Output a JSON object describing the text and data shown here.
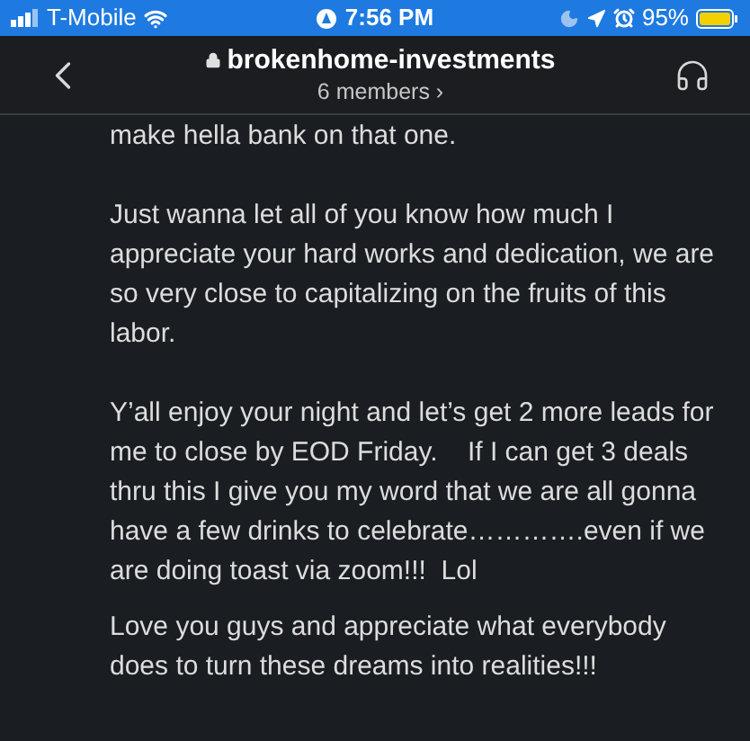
{
  "status_bar": {
    "carrier": "T-Mobile",
    "time": "7:56 PM",
    "battery_percent": "95%"
  },
  "header": {
    "channel": "brokenhome-investments",
    "members": "6 members",
    "members_chevron": "›"
  },
  "messages": [
    {
      "paragraphs": [
        "make hella bank on that one.",
        "Just wanna let all of you know how much I appreciate your hard works and dedication, we are so very close to capitalizing on the fruits of this labor.",
        "Y’all enjoy your night and let’s get 2 more leads for me to close by EOD Friday.    If I can get 3 deals thru this I give you my word that we are all gonna have a few drinks to celebrate………….even if we are doing toast via zoom!!!  Lol"
      ]
    },
    {
      "paragraphs": [
        "Love you guys and appreciate what everybody does to turn these dreams into realities!!!"
      ]
    }
  ]
}
